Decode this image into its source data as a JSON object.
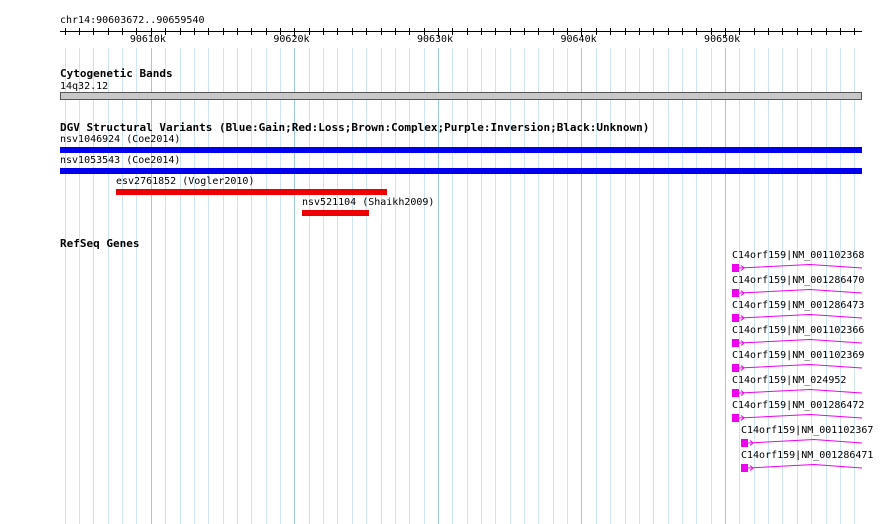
{
  "region": {
    "label": "chr14:90603672..90659540",
    "start": 90603672,
    "end": 90659540
  },
  "ruler": {
    "ticks": [
      {
        "pos": 90610000,
        "label": "90610k"
      },
      {
        "pos": 90620000,
        "label": "90620k"
      },
      {
        "pos": 90630000,
        "label": "90630k"
      },
      {
        "pos": 90640000,
        "label": "90640k"
      },
      {
        "pos": 90650000,
        "label": "90650k"
      }
    ]
  },
  "cytoband": {
    "title": "Cytogenetic Bands",
    "band": "14q32.12",
    "color": "#c8c8c8"
  },
  "dgv": {
    "title": "DGV Structural Variants (Blue:Gain;Red:Loss;Brown:Complex;Purple:Inversion;Black:Unknown)",
    "colors": {
      "gain": "#0000ee",
      "loss": "#ee0000"
    },
    "variants": [
      {
        "label": "nsv1046924 (Coe2014)",
        "type": "gain",
        "start": 90603672,
        "end": 90659540
      },
      {
        "label": "nsv1053543 (Coe2014)",
        "type": "gain",
        "start": 90603672,
        "end": 90659540
      },
      {
        "label": "esv2761852 (Vogler2010)",
        "type": "loss",
        "start": 90607600,
        "end": 90626450
      },
      {
        "label": "nsv521104 (Shaikh2009)",
        "type": "loss",
        "start": 90620500,
        "end": 90625200
      }
    ]
  },
  "refseq": {
    "title": "RefSeq Genes",
    "color": "#ee00ee",
    "genes": [
      {
        "label": "C14orf159|NM_001102368",
        "start": 90650460
      },
      {
        "label": "C14orf159|NM_001286470",
        "start": 90650460
      },
      {
        "label": "C14orf159|NM_001286473",
        "start": 90650460
      },
      {
        "label": "C14orf159|NM_001102366",
        "start": 90650460
      },
      {
        "label": "C14orf159|NM_001102369",
        "start": 90650460
      },
      {
        "label": "C14orf159|NM_024952",
        "start": 90650460
      },
      {
        "label": "C14orf159|NM_001286472",
        "start": 90650460
      },
      {
        "label": "C14orf159|NM_001102367",
        "start": 90651100
      },
      {
        "label": "C14orf159|NM_001286471",
        "start": 90651100
      }
    ]
  }
}
